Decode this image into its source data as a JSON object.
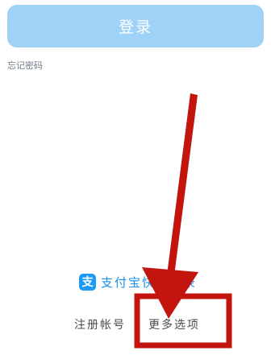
{
  "login": {
    "label": "登录"
  },
  "forgot_password": {
    "label": "忘记密码"
  },
  "alipay": {
    "icon": "alipay-icon",
    "glyph": "支",
    "label": "支付宝快速登录"
  },
  "links": {
    "register": "注册帐号",
    "more_options": "更多选项"
  },
  "colors": {
    "login_button": "#9ed3f7",
    "alipay_blue": "#1b9af7",
    "annotation_red": "#c3140e"
  }
}
